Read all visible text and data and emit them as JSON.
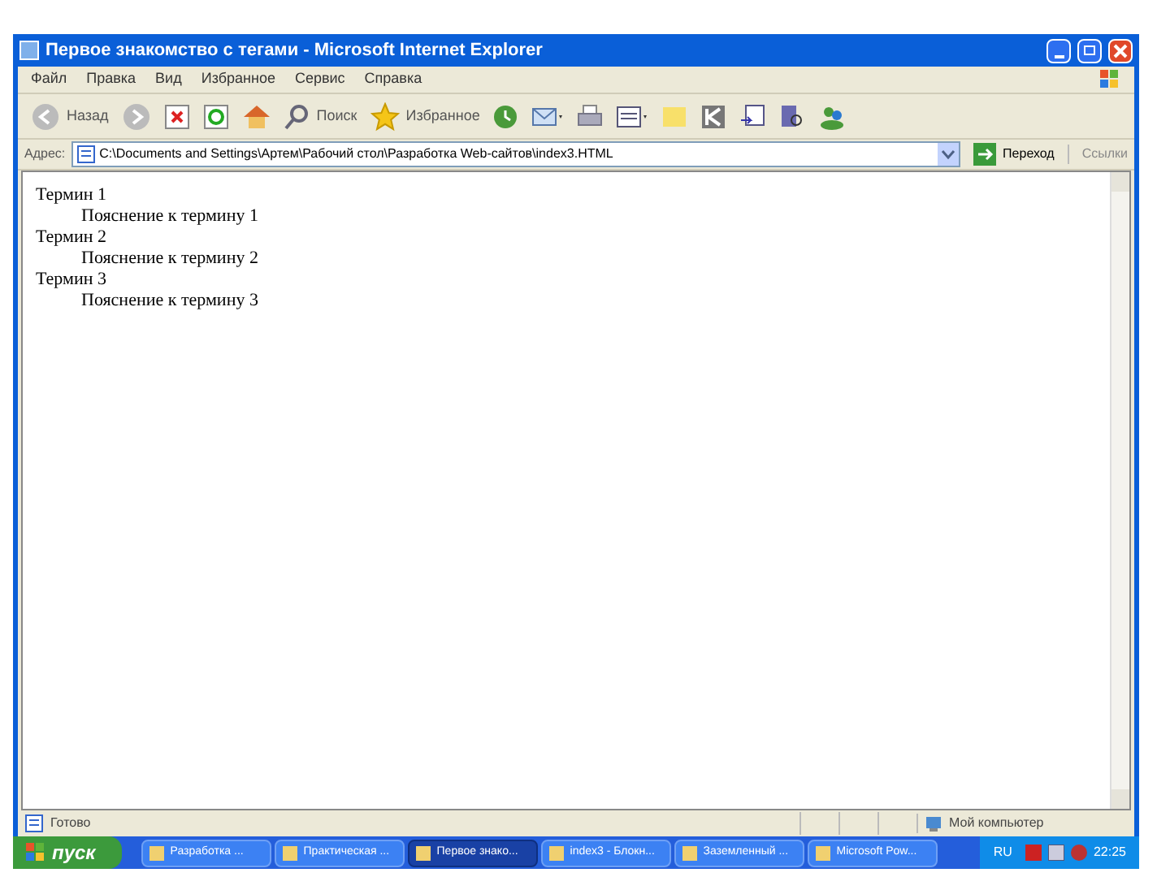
{
  "window": {
    "title": "Первое знакомство с тегами - Microsoft Internet Explorer"
  },
  "menu": [
    "Файл",
    "Правка",
    "Вид",
    "Избранное",
    "Сервис",
    "Справка"
  ],
  "toolbar": {
    "back": "Назад",
    "search": "Поиск",
    "favorites": "Избранное"
  },
  "address_bar": {
    "label": "Адрес:",
    "value": "C:\\Documents and Settings\\Артем\\Рабочий стол\\Разработка Web-сайтов\\index3.HTML",
    "go": "Переход",
    "links": "Ссылки"
  },
  "content": {
    "terms": [
      {
        "term": "Термин 1",
        "definition": "Пояснение к термину 1"
      },
      {
        "term": "Термин 2",
        "definition": "Пояснение к термину 2"
      },
      {
        "term": "Термин 3",
        "definition": "Пояснение к термину 3"
      }
    ]
  },
  "status_bar": {
    "text": "Готово",
    "zone": "Мой компьютер"
  },
  "taskbar": {
    "start": "пуск",
    "tasks": [
      {
        "label": "Разработка ...",
        "selected": false
      },
      {
        "label": "Практическая ...",
        "selected": false
      },
      {
        "label": "Первое знако...",
        "selected": true
      },
      {
        "label": "index3 - Блокн...",
        "selected": false
      },
      {
        "label": "Заземленный ...",
        "selected": false
      },
      {
        "label": "Microsoft Pow...",
        "selected": false
      }
    ],
    "language": "RU",
    "clock": "22:25"
  }
}
